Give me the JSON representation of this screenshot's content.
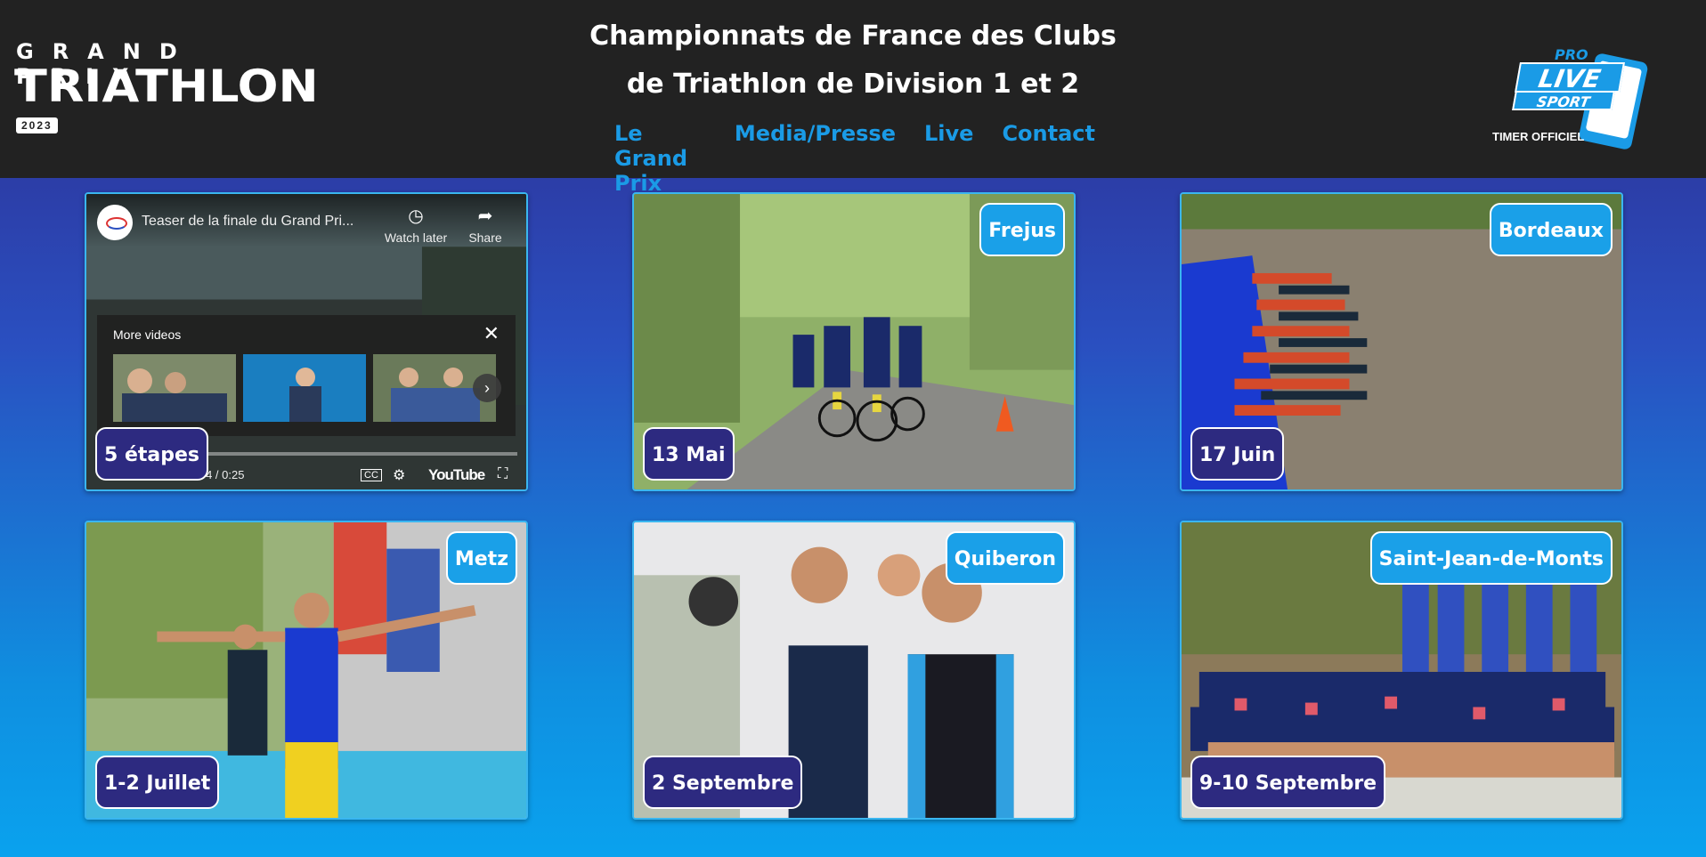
{
  "header": {
    "logo_left": {
      "line1": "GRAND PRIX",
      "line2": "TRIATHLON",
      "year": "2023"
    },
    "title_line1": "Championnats de France des Clubs",
    "title_line2": "de Triathlon de Division 1 et 2",
    "nav": [
      "Le Grand Prix",
      "Media/Presse",
      "Live",
      "Contact"
    ],
    "logo_right": {
      "pro": "PRO",
      "live": "LIVE",
      "sport": "SPORT",
      "caption": "TIMER OFFICIEL"
    }
  },
  "video": {
    "title": "Teaser de la finale du Grand Pri...",
    "watch_later": "Watch later",
    "share": "Share",
    "more_videos": "More videos",
    "time": "0:04 / 0:25",
    "cc": "CC",
    "youtube": "YouTube",
    "overlay_label": "5 étapes"
  },
  "cards": [
    {
      "city": "Frejus",
      "date": "13 Mai"
    },
    {
      "city": "Bordeaux",
      "date": "17 Juin"
    },
    {
      "city": "Metz",
      "date": "1-2 Juillet"
    },
    {
      "city": "Quiberon",
      "date": "2 Septembre"
    },
    {
      "city": "Saint-Jean-de-Monts",
      "date": "9-10 Septembre"
    }
  ],
  "colors": {
    "header_bg": "#222222",
    "nav_link": "#1a9be6",
    "city_label": "#1aa0e8",
    "date_label": "#2d2a80"
  }
}
